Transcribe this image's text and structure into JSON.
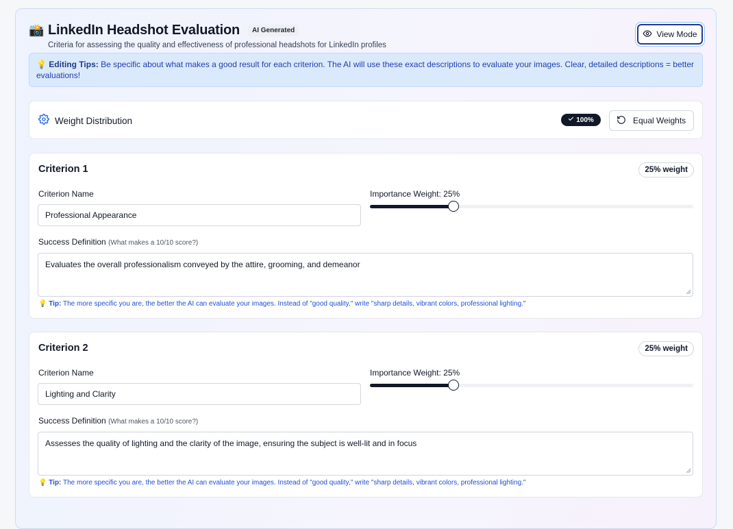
{
  "header": {
    "camera_icon": "📸",
    "title": "LinkedIn Headshot Evaluation",
    "ai_badge": "AI Generated",
    "subtitle": "Criteria for assessing the quality and effectiveness of professional headshots for LinkedIn profiles",
    "view_mode_label": "View Mode"
  },
  "tips": {
    "icon": "💡",
    "label": "Editing Tips:",
    "text": " Be specific about what makes a good result for each criterion. The AI will use these exact descriptions to evaluate your images. Clear, detailed descriptions = better evaluations!"
  },
  "weight_distribution": {
    "title": "Weight Distribution",
    "total_badge": "100%",
    "equal_weights_label": "Equal Weights"
  },
  "labels": {
    "criterion_name": "Criterion Name",
    "success_definition": "Success Definition",
    "success_hint": "(What makes a 10/10 score?)",
    "tip_icon": "💡",
    "tip_label": "Tip:",
    "tip_text": " The more specific you are, the better the AI can evaluate your images. Instead of \"good quality,\" write \"sharp details, vibrant colors, professional lighting.\""
  },
  "criteria": [
    {
      "title": "Criterion 1",
      "weight_pill": "25% weight",
      "importance_label": "Importance Weight: 25%",
      "weight_fraction": 0.25,
      "name": "Professional Appearance",
      "definition": "Evaluates the overall professionalism conveyed by the attire, grooming, and demeanor"
    },
    {
      "title": "Criterion 2",
      "weight_pill": "25% weight",
      "importance_label": "Importance Weight: 25%",
      "weight_fraction": 0.25,
      "name": "Lighting and Clarity",
      "definition": "Assesses the quality of lighting and the clarity of the image, ensuring the subject is well-lit and in focus"
    }
  ]
}
